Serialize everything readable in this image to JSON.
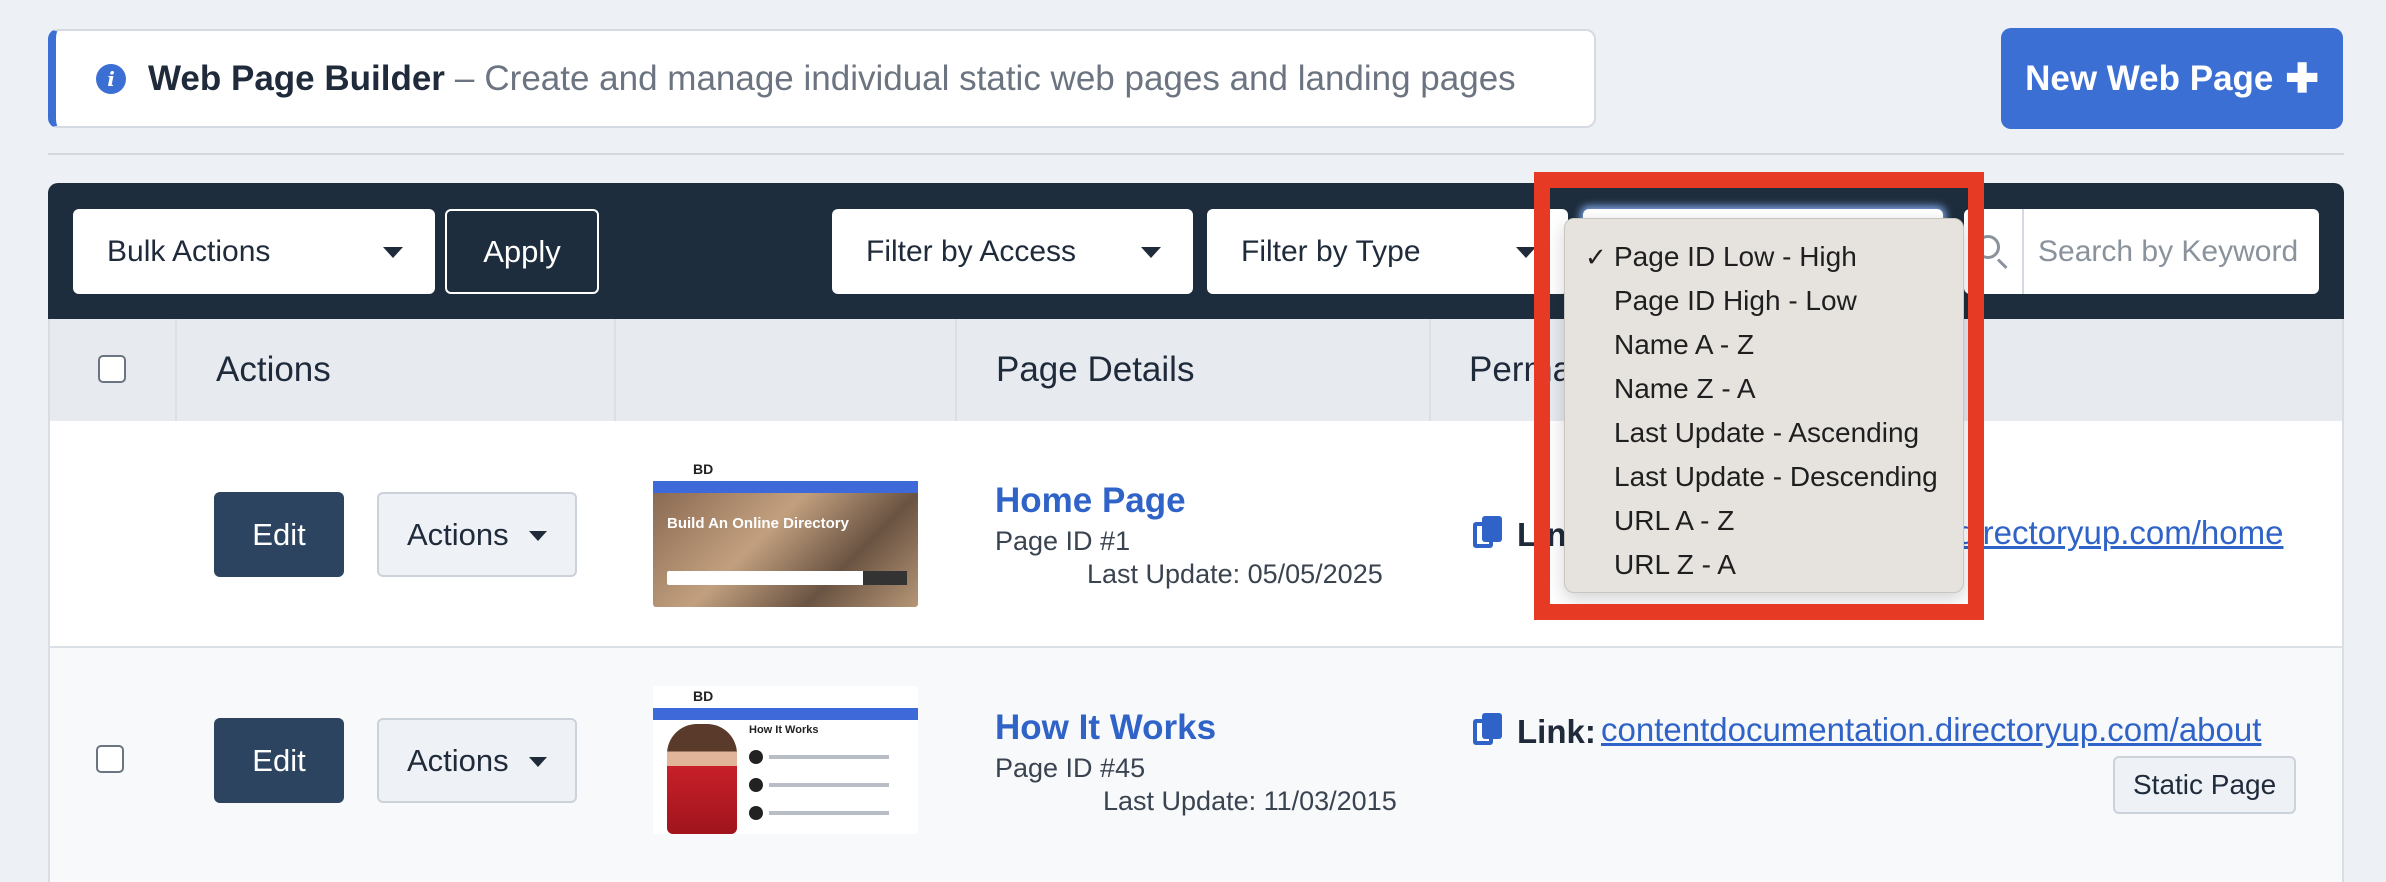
{
  "header": {
    "title": "Web Page Builder",
    "separator": "–",
    "description": "Create and manage individual static web pages and landing pages",
    "new_button": "New Web Page",
    "new_button_icon": "plus-icon"
  },
  "toolbar": {
    "bulk_actions": "Bulk Actions",
    "apply": "Apply",
    "filter_access": "Filter by Access",
    "filter_type": "Filter by Type",
    "search_placeholder": "Search by Keyword"
  },
  "sort_dropdown": {
    "options": [
      "Page ID Low - High",
      "Page ID High - Low",
      "Name A - Z",
      "Name Z - A",
      "Last Update - Ascending",
      "Last Update - Descending",
      "URL A - Z",
      "URL Z - A"
    ],
    "selected": "Page ID Low - High",
    "check": "✓"
  },
  "table": {
    "headers": {
      "actions": "Actions",
      "details": "Page Details",
      "permalink": "Perma"
    },
    "edit_label": "Edit",
    "actions_label": "Actions",
    "link_label": "Link:",
    "rows": [
      {
        "name": "Home Page",
        "page_id": "Page ID #1",
        "last_update": "Last Update: 05/05/2025",
        "link_prefix": "Lin",
        "url_visible": "directoryup.com/home",
        "thumb": {
          "logo": "BD",
          "headline": "Build An Online Directory"
        }
      },
      {
        "name": "How It Works",
        "page_id": "Page ID #45",
        "last_update": "Last Update: 11/03/2015",
        "url": "contentdocumentation.directoryup.com/about",
        "tag": "Static Page",
        "thumb": {
          "logo": "BD",
          "headline": "How It Works"
        }
      }
    ]
  },
  "colors": {
    "accent": "#3b6fd4",
    "toolbar_bg": "#1e2d3d",
    "edit_bg": "#2c4460",
    "highlight": "#e63a24"
  }
}
